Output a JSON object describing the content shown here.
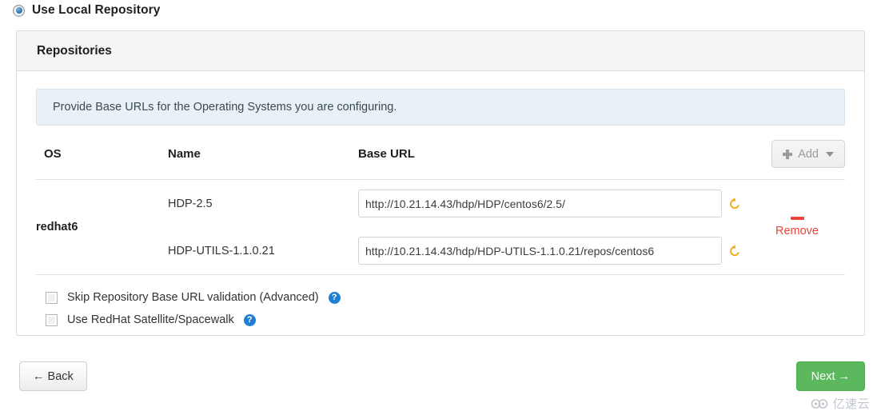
{
  "option": {
    "label": "Use Local Repository",
    "selected": true,
    "control": "radio"
  },
  "panel": {
    "title": "Repositories",
    "alert": {
      "icon": "info-icon",
      "text": "Provide Base URLs for the Operating Systems you are configuring."
    },
    "table": {
      "headers": {
        "os": "OS",
        "name": "Name",
        "base_url": "Base URL"
      },
      "add_button": {
        "label": "Add",
        "icon": "plus-icon",
        "caret": "chevron-down-icon",
        "disabled": true
      },
      "rows": [
        {
          "os": "redhat6",
          "repos": [
            {
              "name": "HDP-2.5",
              "base_url": "http://10.21.14.43/hdp/HDP/centos6/2.5/",
              "undo_icon": "undo-icon"
            },
            {
              "name": "HDP-UTILS-1.1.0.21",
              "base_url": "http://10.21.14.43/hdp/HDP-UTILS-1.1.0.21/repos/centos6",
              "undo_icon": "undo-icon"
            }
          ],
          "remove": {
            "label": "Remove",
            "icon": "minus-icon"
          }
        }
      ]
    },
    "checkboxes": [
      {
        "label": "Skip Repository Base URL validation (Advanced)",
        "checked": false,
        "help_icon": "help-icon",
        "help_glyph": "?"
      },
      {
        "label": "Use RedHat Satellite/Spacewalk",
        "checked": false,
        "help_icon": "help-icon",
        "help_glyph": "?"
      }
    ]
  },
  "footer": {
    "back_label": "← Back",
    "next_label": "Next →"
  },
  "watermark": {
    "text": "亿速云"
  },
  "colors": {
    "accent_green": "#5cb85c",
    "danger_red": "#e8453c",
    "link_blue": "#1f7fd4",
    "undo_orange": "#f0ad21",
    "info_bg": "#e9f1f6",
    "panel_head_bg": "#f4f4f4",
    "border": "#dcdcdc"
  }
}
